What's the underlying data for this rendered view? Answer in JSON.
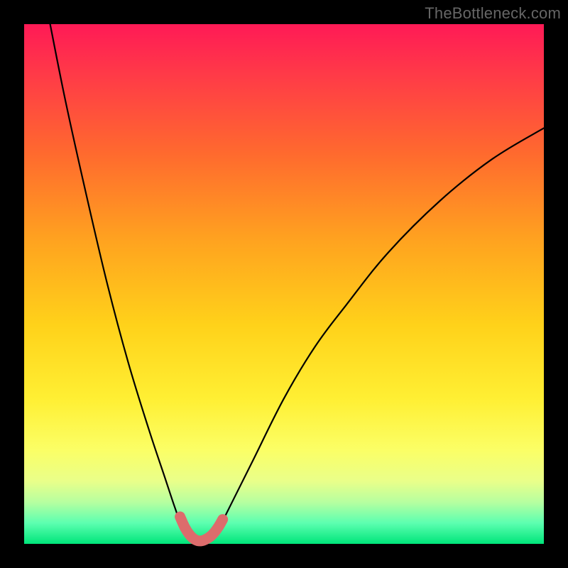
{
  "watermark": "TheBottleneck.com",
  "chart_data": {
    "type": "line",
    "title": "",
    "xlabel": "",
    "ylabel": "",
    "xlim": [
      0,
      100
    ],
    "ylim": [
      0,
      100
    ],
    "series": [
      {
        "name": "curve",
        "x": [
          5,
          8,
          12,
          16,
          20,
          24,
          27,
          29,
          30.5,
          32,
          33,
          33.8,
          34.5,
          36,
          37,
          38,
          40,
          44,
          50,
          56,
          62,
          70,
          80,
          90,
          100
        ],
        "y": [
          100,
          85,
          67,
          50,
          35,
          22,
          13,
          7,
          3,
          1,
          0,
          0,
          0,
          1,
          2,
          4,
          8,
          16,
          28,
          38,
          46,
          56,
          66,
          74,
          80
        ]
      },
      {
        "name": "highlight",
        "x": [
          30,
          30.9,
          31.8,
          32.6,
          33.4,
          34.2,
          35.0,
          35.8,
          36.6,
          37.4,
          38.2
        ],
        "y": [
          5.2,
          3.2,
          1.8,
          1.0,
          0.6,
          0.6,
          0.9,
          1.4,
          2.2,
          3.3,
          4.7
        ]
      }
    ],
    "colors": {
      "curve": "#000000",
      "highlight": "#dd6c6c",
      "gradient_top": "#ff1a56",
      "gradient_mid": "#ffe23a",
      "gradient_bottom": "#00e57a"
    }
  }
}
